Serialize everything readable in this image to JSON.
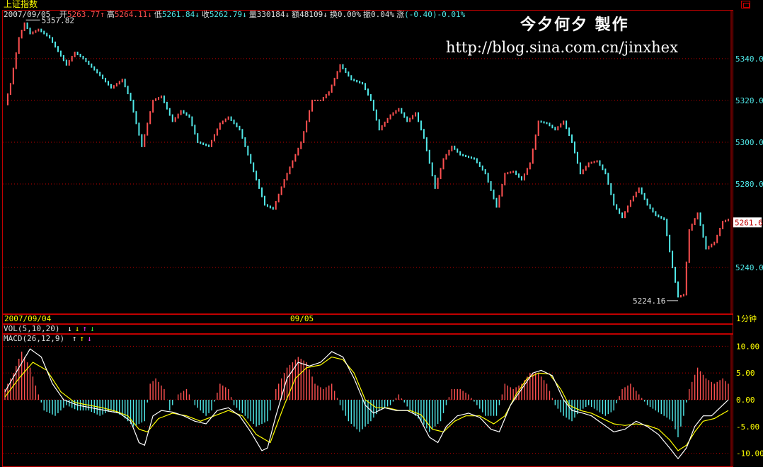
{
  "header": {
    "index_name": "上证指数",
    "date": "2007/09/05",
    "quote_items": [
      {
        "label": "开",
        "value": "5263.77",
        "arrow": "↑",
        "color": "#ff5050"
      },
      {
        "label": "高",
        "value": "5264.11",
        "arrow": "↓",
        "color": "#ff5050"
      },
      {
        "label": "低",
        "value": "5261.84",
        "arrow": "↓",
        "color": "#50e8e8"
      },
      {
        "label": "收",
        "value": "5262.79",
        "arrow": "↓",
        "color": "#50e8e8"
      },
      {
        "label": "量",
        "value": "330184",
        "arrow": "↓",
        "color": "#e0e0e0"
      },
      {
        "label": "额",
        "value": "48109",
        "arrow": "↓",
        "color": "#e0e0e0"
      },
      {
        "label": "换",
        "value": "0.00%",
        "arrow": "",
        "color": "#e0e0e0"
      },
      {
        "label": "振",
        "value": "0.04%",
        "arrow": "",
        "color": "#e0e0e0"
      },
      {
        "label": "涨",
        "value": "(-0.40)-0.01%",
        "arrow": "",
        "color": "#50e8e8"
      }
    ]
  },
  "watermark": {
    "name": "今夕何夕  製作",
    "url": "http://blog.sina.com.cn/jinxhex"
  },
  "axis": {
    "start_date": "2007/09/04",
    "mid_date": "09/05",
    "period": "1分钟"
  },
  "indicators": {
    "vol": {
      "label": "VOL(5,10,20)",
      "arrows": [
        {
          "s": "↓",
          "c": "#ffffff"
        },
        {
          "s": "↓",
          "c": "#ffff00"
        },
        {
          "s": "↑",
          "c": "#ff40ff"
        },
        {
          "s": "↓",
          "c": "#40ff40"
        }
      ]
    },
    "macd": {
      "label": "MACD(26,12,9)",
      "arrows": [
        {
          "s": "↑",
          "c": "#ffffff"
        },
        {
          "s": "↑",
          "c": "#ffff00"
        },
        {
          "s": "↓",
          "c": "#ff40ff"
        }
      ]
    }
  },
  "colors": {
    "up": "#ff5050",
    "down": "#50e8e8",
    "grid": "#c00000",
    "dif": "#ffffff",
    "dea": "#ffff00"
  },
  "chart_data": [
    {
      "type": "line",
      "name": "price",
      "ylim": [
        5218,
        5363
      ],
      "ticks": [
        5340,
        5320,
        5300,
        5280,
        5240
      ],
      "tick_labels": [
        "5340.0",
        "5320.0",
        "5300.0",
        "5280.0",
        "5240.0"
      ],
      "current_price_label": "5261.6",
      "current_price": 5261.6,
      "high_label": "5357.82",
      "high": 5357.82,
      "low_label": "5224.16",
      "low": 5224.16,
      "anchors": [
        [
          0,
          5318
        ],
        [
          2,
          5328
        ],
        [
          5,
          5350
        ],
        [
          7,
          5357
        ],
        [
          9,
          5352
        ],
        [
          12,
          5354
        ],
        [
          16,
          5350
        ],
        [
          22,
          5337
        ],
        [
          25,
          5343
        ],
        [
          28,
          5340
        ],
        [
          34,
          5332
        ],
        [
          38,
          5326
        ],
        [
          42,
          5330
        ],
        [
          45,
          5320
        ],
        [
          49,
          5298
        ],
        [
          53,
          5320
        ],
        [
          56,
          5322
        ],
        [
          60,
          5310
        ],
        [
          63,
          5315
        ],
        [
          66,
          5312
        ],
        [
          69,
          5300
        ],
        [
          73,
          5298
        ],
        [
          77,
          5309
        ],
        [
          80,
          5312
        ],
        [
          84,
          5306
        ],
        [
          88,
          5290
        ],
        [
          93,
          5270
        ],
        [
          96,
          5268
        ],
        [
          100,
          5282
        ],
        [
          106,
          5300
        ],
        [
          110,
          5320
        ],
        [
          113,
          5320
        ],
        [
          116,
          5324
        ],
        [
          120,
          5337
        ],
        [
          124,
          5330
        ],
        [
          128,
          5328
        ],
        [
          131,
          5320
        ],
        [
          134,
          5306
        ],
        [
          138,
          5313
        ],
        [
          141,
          5316
        ],
        [
          144,
          5310
        ],
        [
          147,
          5314
        ],
        [
          150,
          5302
        ],
        [
          154,
          5278
        ],
        [
          157,
          5292
        ],
        [
          160,
          5298
        ],
        [
          163,
          5294
        ],
        [
          168,
          5292
        ],
        [
          172,
          5285
        ],
        [
          176,
          5269
        ],
        [
          179,
          5285
        ],
        [
          182,
          5286
        ],
        [
          185,
          5282
        ],
        [
          188,
          5290
        ],
        [
          191,
          5310
        ],
        [
          194,
          5309
        ],
        [
          197,
          5306
        ],
        [
          200,
          5310
        ],
        [
          203,
          5300
        ],
        [
          206,
          5285
        ],
        [
          209,
          5290
        ],
        [
          212,
          5291
        ],
        [
          215,
          5285
        ],
        [
          218,
          5270
        ],
        [
          221,
          5264
        ],
        [
          224,
          5272
        ],
        [
          227,
          5278
        ],
        [
          230,
          5270
        ],
        [
          233,
          5265
        ],
        [
          236,
          5263
        ],
        [
          239,
          5240
        ],
        [
          241,
          5226
        ],
        [
          243,
          5227
        ],
        [
          245,
          5258
        ],
        [
          248,
          5266
        ],
        [
          251,
          5249
        ],
        [
          254,
          5252
        ],
        [
          257,
          5262
        ],
        [
          259,
          5263
        ]
      ]
    },
    {
      "type": "bar",
      "name": "macd",
      "ylim": [
        -11.5,
        11.5
      ],
      "ticks": [
        10,
        5,
        0,
        -5,
        -10
      ],
      "tick_labels": [
        "10.00",
        "5.00",
        "0.00",
        "-5.00",
        "-10.00"
      ],
      "bar_anchors": [
        [
          0,
          2
        ],
        [
          3,
          5
        ],
        [
          6,
          9
        ],
        [
          9,
          6
        ],
        [
          12,
          1
        ],
        [
          14,
          -2
        ],
        [
          18,
          -3
        ],
        [
          22,
          -1
        ],
        [
          26,
          -2
        ],
        [
          30,
          -2
        ],
        [
          34,
          -3
        ],
        [
          38,
          -2
        ],
        [
          42,
          -3
        ],
        [
          46,
          -5
        ],
        [
          50,
          -4
        ],
        [
          52,
          3
        ],
        [
          54,
          4
        ],
        [
          57,
          2
        ],
        [
          59,
          -2
        ],
        [
          62,
          1
        ],
        [
          65,
          2
        ],
        [
          68,
          -1
        ],
        [
          72,
          -3
        ],
        [
          74,
          -2
        ],
        [
          77,
          3
        ],
        [
          80,
          2
        ],
        [
          82,
          -1
        ],
        [
          86,
          -3
        ],
        [
          90,
          -5
        ],
        [
          94,
          -4
        ],
        [
          97,
          2
        ],
        [
          101,
          6
        ],
        [
          105,
          8
        ],
        [
          108,
          7
        ],
        [
          111,
          3
        ],
        [
          114,
          2
        ],
        [
          117,
          3
        ],
        [
          120,
          -1
        ],
        [
          123,
          -4
        ],
        [
          127,
          -6
        ],
        [
          131,
          -4
        ],
        [
          134,
          -2
        ],
        [
          138,
          -1
        ],
        [
          141,
          1
        ],
        [
          145,
          -2
        ],
        [
          149,
          -4
        ],
        [
          152,
          -6
        ],
        [
          156,
          -4
        ],
        [
          160,
          2
        ],
        [
          163,
          2
        ],
        [
          166,
          1
        ],
        [
          169,
          -1
        ],
        [
          172,
          -3
        ],
        [
          176,
          -3
        ],
        [
          179,
          3
        ],
        [
          182,
          2
        ],
        [
          185,
          3
        ],
        [
          188,
          5
        ],
        [
          191,
          5
        ],
        [
          194,
          3
        ],
        [
          197,
          -1
        ],
        [
          200,
          -3
        ],
        [
          203,
          -4
        ],
        [
          206,
          -2
        ],
        [
          209,
          -1
        ],
        [
          212,
          -2
        ],
        [
          215,
          -3
        ],
        [
          218,
          -2
        ],
        [
          221,
          2
        ],
        [
          224,
          3
        ],
        [
          227,
          1
        ],
        [
          230,
          -1
        ],
        [
          233,
          -2
        ],
        [
          236,
          -3
        ],
        [
          239,
          -4
        ],
        [
          241,
          -7
        ],
        [
          243,
          -3
        ],
        [
          245,
          2
        ],
        [
          248,
          6
        ],
        [
          251,
          4
        ],
        [
          254,
          3
        ],
        [
          257,
          4
        ],
        [
          259,
          3
        ]
      ],
      "dif_anchors": [
        [
          0,
          1.5
        ],
        [
          5,
          6
        ],
        [
          9,
          9.5
        ],
        [
          13,
          8
        ],
        [
          17,
          3
        ],
        [
          21,
          0
        ],
        [
          26,
          -1
        ],
        [
          31,
          -1.5
        ],
        [
          36,
          -2
        ],
        [
          41,
          -2.5
        ],
        [
          45,
          -4
        ],
        [
          48,
          -8
        ],
        [
          50,
          -8.5
        ],
        [
          53,
          -3
        ],
        [
          56,
          -2
        ],
        [
          60,
          -2.3
        ],
        [
          64,
          -3
        ],
        [
          68,
          -4
        ],
        [
          72,
          -4.5
        ],
        [
          76,
          -2
        ],
        [
          80,
          -1.5
        ],
        [
          84,
          -3
        ],
        [
          88,
          -6
        ],
        [
          92,
          -9.5
        ],
        [
          94,
          -9
        ],
        [
          97,
          -3
        ],
        [
          101,
          4
        ],
        [
          105,
          7
        ],
        [
          109,
          6.3
        ],
        [
          113,
          7
        ],
        [
          117,
          9
        ],
        [
          121,
          8
        ],
        [
          125,
          4
        ],
        [
          129,
          -1
        ],
        [
          132,
          -2.5
        ],
        [
          136,
          -1.5
        ],
        [
          140,
          -2
        ],
        [
          144,
          -2
        ],
        [
          148,
          -3
        ],
        [
          152,
          -7
        ],
        [
          155,
          -8
        ],
        [
          158,
          -5
        ],
        [
          162,
          -3
        ],
        [
          166,
          -2.5
        ],
        [
          170,
          -3.3
        ],
        [
          174,
          -5.5
        ],
        [
          177,
          -6
        ],
        [
          181,
          -1
        ],
        [
          185,
          2
        ],
        [
          189,
          5
        ],
        [
          192,
          5.5
        ],
        [
          196,
          4.5
        ],
        [
          200,
          0
        ],
        [
          203,
          -2
        ],
        [
          207,
          -2.5
        ],
        [
          210,
          -3
        ],
        [
          214,
          -4.5
        ],
        [
          218,
          -6
        ],
        [
          222,
          -5.5
        ],
        [
          226,
          -4
        ],
        [
          230,
          -5
        ],
        [
          234,
          -6.5
        ],
        [
          238,
          -9
        ],
        [
          241,
          -11
        ],
        [
          244,
          -9
        ],
        [
          247,
          -5
        ],
        [
          250,
          -3
        ],
        [
          253,
          -3
        ],
        [
          256,
          -1.5
        ],
        [
          259,
          0
        ]
      ],
      "dea_anchors": [
        [
          0,
          0.5
        ],
        [
          5,
          4
        ],
        [
          10,
          7
        ],
        [
          15,
          5.5
        ],
        [
          20,
          1.5
        ],
        [
          25,
          -0.5
        ],
        [
          30,
          -1
        ],
        [
          35,
          -1.5
        ],
        [
          40,
          -2.2
        ],
        [
          44,
          -3
        ],
        [
          48,
          -5.5
        ],
        [
          51,
          -6
        ],
        [
          55,
          -3.5
        ],
        [
          60,
          -2.5
        ],
        [
          65,
          -3
        ],
        [
          70,
          -4
        ],
        [
          75,
          -3
        ],
        [
          80,
          -2
        ],
        [
          85,
          -3
        ],
        [
          90,
          -6.5
        ],
        [
          95,
          -8
        ],
        [
          100,
          -1
        ],
        [
          104,
          4
        ],
        [
          108,
          6
        ],
        [
          113,
          6.5
        ],
        [
          117,
          8
        ],
        [
          121,
          7.5
        ],
        [
          125,
          5
        ],
        [
          129,
          0
        ],
        [
          133,
          -1.5
        ],
        [
          137,
          -1.5
        ],
        [
          141,
          -2
        ],
        [
          145,
          -2
        ],
        [
          149,
          -2.8
        ],
        [
          153,
          -5.5
        ],
        [
          157,
          -6
        ],
        [
          161,
          -4
        ],
        [
          165,
          -3
        ],
        [
          170,
          -3
        ],
        [
          175,
          -4.5
        ],
        [
          179,
          -3
        ],
        [
          183,
          1
        ],
        [
          187,
          4
        ],
        [
          191,
          5
        ],
        [
          195,
          4.8
        ],
        [
          199,
          2
        ],
        [
          202,
          -1
        ],
        [
          206,
          -2
        ],
        [
          210,
          -2.5
        ],
        [
          214,
          -3.5
        ],
        [
          218,
          -4.5
        ],
        [
          222,
          -4.8
        ],
        [
          226,
          -4.5
        ],
        [
          230,
          -4.8
        ],
        [
          234,
          -5.5
        ],
        [
          238,
          -7.5
        ],
        [
          241,
          -9.5
        ],
        [
          244,
          -8.5
        ],
        [
          247,
          -6
        ],
        [
          250,
          -4
        ],
        [
          254,
          -3.5
        ],
        [
          259,
          -2
        ]
      ]
    }
  ]
}
